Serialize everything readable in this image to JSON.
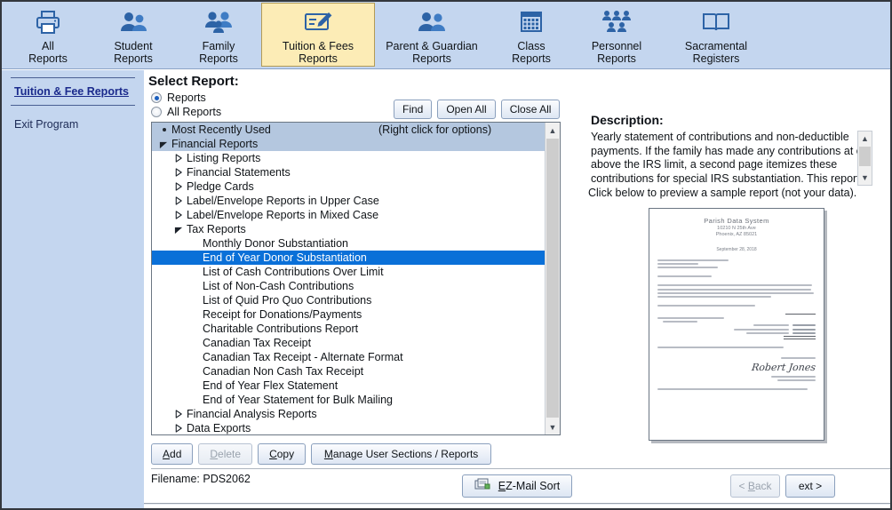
{
  "toolbar": {
    "items": [
      {
        "label": "All\nReports",
        "icon": "printer-icon",
        "active": false
      },
      {
        "label": "Student\nReports",
        "icon": "students-icon",
        "active": false
      },
      {
        "label": "Family\nReports",
        "icon": "family-icon",
        "active": false
      },
      {
        "label": "Tuition & Fees\nReports",
        "icon": "form-pencil-icon",
        "active": true
      },
      {
        "label": "Parent & Guardian\nReports",
        "icon": "parents-icon",
        "active": false
      },
      {
        "label": "Class\nReports",
        "icon": "grid-calendar-icon",
        "active": false
      },
      {
        "label": "Personnel\nReports",
        "icon": "personnel-group-icon",
        "active": false
      },
      {
        "label": "Sacramental\nRegisters",
        "icon": "open-book-icon",
        "active": false
      }
    ]
  },
  "sidebar": {
    "links": [
      {
        "label": "Tuition & Fee Reports",
        "style": "link"
      },
      {
        "label": "Exit Program",
        "style": "plain"
      }
    ]
  },
  "main": {
    "title": "Select Report:",
    "radios": [
      {
        "label": "Reports",
        "selected": true
      },
      {
        "label": "All Reports",
        "selected": false
      }
    ],
    "top_buttons": [
      {
        "label": "Find",
        "disabled": false
      },
      {
        "label": "Open All",
        "disabled": false
      },
      {
        "label": "Close All",
        "disabled": false
      }
    ],
    "tree_hint": "(Right click for options)",
    "tree": [
      {
        "label": "Most Recently Used",
        "indent": 0,
        "marker": "bullet",
        "state": "header"
      },
      {
        "label": "Financial Reports",
        "indent": 0,
        "marker": "open",
        "state": "header"
      },
      {
        "label": "Listing Reports",
        "indent": 1,
        "marker": "closed",
        "state": "normal"
      },
      {
        "label": "Financial Statements",
        "indent": 1,
        "marker": "closed",
        "state": "normal"
      },
      {
        "label": "Pledge Cards",
        "indent": 1,
        "marker": "closed",
        "state": "normal"
      },
      {
        "label": "Label/Envelope Reports in Upper Case",
        "indent": 1,
        "marker": "closed",
        "state": "normal"
      },
      {
        "label": "Label/Envelope Reports in Mixed Case",
        "indent": 1,
        "marker": "closed",
        "state": "normal"
      },
      {
        "label": "Tax Reports",
        "indent": 1,
        "marker": "open",
        "state": "normal"
      },
      {
        "label": "Monthly Donor Substantiation",
        "indent": 2,
        "marker": "none",
        "state": "normal"
      },
      {
        "label": "End of Year Donor Substantiation",
        "indent": 2,
        "marker": "none",
        "state": "selected"
      },
      {
        "label": "List of Cash Contributions Over Limit",
        "indent": 2,
        "marker": "none",
        "state": "normal"
      },
      {
        "label": "List of Non-Cash Contributions",
        "indent": 2,
        "marker": "none",
        "state": "normal"
      },
      {
        "label": "List of Quid Pro Quo Contributions",
        "indent": 2,
        "marker": "none",
        "state": "normal"
      },
      {
        "label": "Receipt for Donations/Payments",
        "indent": 2,
        "marker": "none",
        "state": "normal"
      },
      {
        "label": "Charitable Contributions Report",
        "indent": 2,
        "marker": "none",
        "state": "normal"
      },
      {
        "label": "Canadian Tax Receipt",
        "indent": 2,
        "marker": "none",
        "state": "normal"
      },
      {
        "label": "Canadian Tax Receipt - Alternate Format",
        "indent": 2,
        "marker": "none",
        "state": "normal"
      },
      {
        "label": "Canadian Non Cash Tax Receipt",
        "indent": 2,
        "marker": "none",
        "state": "normal"
      },
      {
        "label": "End of Year Flex Statement",
        "indent": 2,
        "marker": "none",
        "state": "normal"
      },
      {
        "label": "End of Year Statement for Bulk Mailing",
        "indent": 2,
        "marker": "none",
        "state": "normal"
      },
      {
        "label": "Financial Analysis Reports",
        "indent": 1,
        "marker": "closed",
        "state": "normal"
      },
      {
        "label": "Data Exports",
        "indent": 1,
        "marker": "closed",
        "state": "normal"
      }
    ],
    "action_buttons": [
      {
        "label": "Add",
        "accel": "A",
        "disabled": false
      },
      {
        "label": "Delete",
        "accel": "D",
        "disabled": true
      },
      {
        "label": "Copy",
        "accel": "C",
        "disabled": false
      },
      {
        "label": "Manage User Sections / Reports",
        "accel": "M",
        "disabled": false
      }
    ],
    "filename": "Filename: PDS2062",
    "ez_mail_sort": "EZ-Mail Sort",
    "back_button": "< Back",
    "next_button": "Next >"
  },
  "description": {
    "title": "Description:",
    "body": "Yearly statement of contributions and non-deductible payments.  If the family has made any contributions at or above the IRS limit, a second page itemizes these contributions for special IRS substantiation. This report is not intended for",
    "click_hint": "Click below to preview a sample report (not your data)."
  },
  "preview": {
    "org_name": "Parish Data System",
    "address_line": "10210 N 25th Ave",
    "city_line": "Phoenix, AZ   85021",
    "date": "September 28, 2018"
  },
  "colors": {
    "toolbar_bg": "#c4d6ef",
    "active_tab_bg": "#fcecb6",
    "icon_blue": "#2d63a6",
    "selection_blue": "#0a70d8",
    "tree_header_bg": "#b4c7df",
    "link_blue": "#1a2a8c"
  }
}
